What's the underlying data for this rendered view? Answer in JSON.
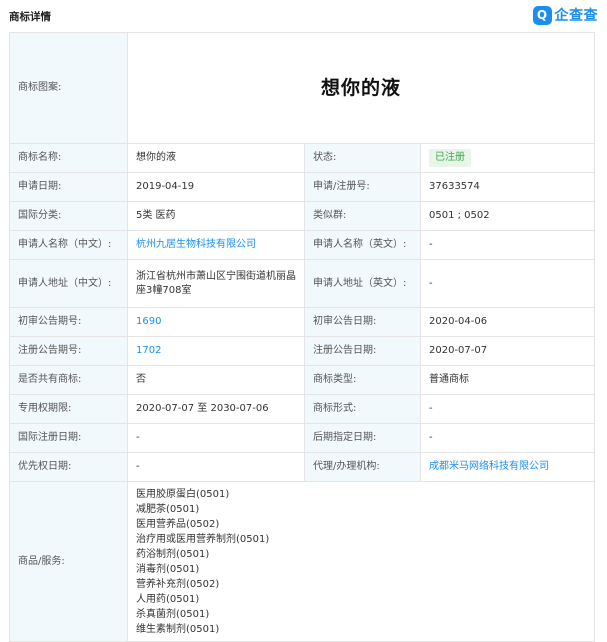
{
  "header": {
    "section_title": "商标详情",
    "logo_text": "企查查",
    "logo_glyph": "Q"
  },
  "rows": {
    "image_label": "商标图案:",
    "image_text": "想你的液",
    "name_label": "商标名称:",
    "name_value": "想你的液",
    "status_label": "状态:",
    "status_value": "已注册",
    "apply_date_label": "申请日期:",
    "apply_date_value": "2019-04-19",
    "reg_no_label": "申请/注册号:",
    "reg_no_value": "37633574",
    "intl_class_label": "国际分类:",
    "intl_class_value": "5类 医药",
    "group_label": "类似群:",
    "group_value": "0501 ; 0502",
    "applicant_cn_label": "申请人名称（中文）:",
    "applicant_cn_value": "杭州九居生物科技有限公司",
    "applicant_en_label": "申请人名称（英文）:",
    "applicant_en_value": "-",
    "address_cn_label": "申请人地址（中文）:",
    "address_cn_value": "浙江省杭州市萧山区宁围街道机丽晶座3幢708室",
    "address_en_label": "申请人地址（英文）:",
    "address_en_value": "-",
    "prelim_no_label": "初审公告期号:",
    "prelim_no_value": "1690",
    "prelim_date_label": "初审公告日期:",
    "prelim_date_value": "2020-04-06",
    "reg_pub_no_label": "注册公告期号:",
    "reg_pub_no_value": "1702",
    "reg_pub_date_label": "注册公告日期:",
    "reg_pub_date_value": "2020-07-07",
    "shared_label": "是否共有商标:",
    "shared_value": "否",
    "type_label": "商标类型:",
    "type_value": "普通商标",
    "term_label": "专用权期限:",
    "term_value": "2020-07-07 至 2030-07-06",
    "form_label": "商标形式:",
    "form_value": "-",
    "intl_reg_date_label": "国际注册日期:",
    "intl_reg_date_value": "-",
    "later_date_label": "后期指定日期:",
    "later_date_value": "-",
    "priority_label": "优先权日期:",
    "priority_value": "-",
    "agent_label": "代理/办理机构:",
    "agent_value": "成都米马网络科技有限公司",
    "services_label": "商品/服务:"
  },
  "services": [
    "医用胶原蛋白(0501)",
    "减肥茶(0501)",
    "医用营养品(0502)",
    "治疗用或医用营养制剂(0501)",
    "药浴制剂(0501)",
    "消毒剂(0501)",
    "营养补充剂(0502)",
    "人用药(0501)",
    "杀真菌剂(0501)",
    "维生素制剂(0501)"
  ]
}
